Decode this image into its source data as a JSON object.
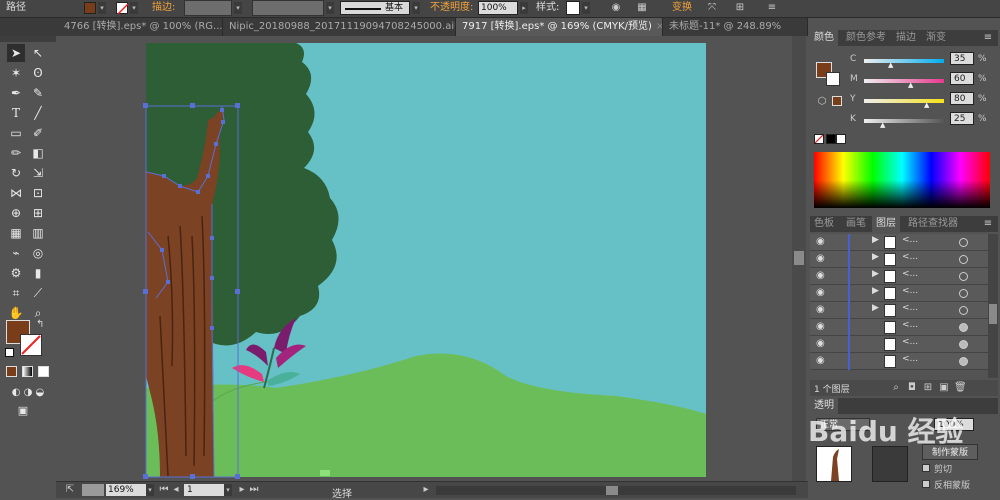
{
  "control_bar": {
    "object_label": "路径",
    "stroke_label": "描边:",
    "stroke_style": "基本",
    "opacity_label": "不透明度:",
    "opacity_value": "100%",
    "style_label": "样式:",
    "transform_label": "变换",
    "fill_color": "#7a3d1a"
  },
  "tabs": [
    {
      "label": "4766 [转换].eps* @ 100% (RG...",
      "close": "×"
    },
    {
      "label": "Nipic_20180988_20171119094708245000.ai*",
      "close": "×"
    },
    {
      "label": "7917 [转换].eps* @ 169% (CMYK/预览)",
      "close": "×"
    },
    {
      "label": "未标题-11* @ 248.89%",
      "close": ""
    }
  ],
  "status_bar": {
    "zoom": "169%",
    "artboard": "1",
    "tool_name": "选择"
  },
  "color_panel": {
    "tabs": [
      "颜色",
      "颜色参考",
      "描边",
      "渐变"
    ],
    "channels": [
      {
        "label": "C",
        "value": "35",
        "percent": 35,
        "color": "#00aeef"
      },
      {
        "label": "M",
        "value": "60",
        "percent": 60,
        "color": "#e8398e"
      },
      {
        "label": "Y",
        "value": "80",
        "percent": 80,
        "color": "#f5e11a"
      },
      {
        "label": "K",
        "value": "25",
        "percent": 25,
        "color": "#555555"
      }
    ],
    "percent_sign": "%"
  },
  "layers_panel": {
    "tabs": [
      "色板",
      "画笔",
      "图层",
      "路径查找器"
    ],
    "row_label": "<...",
    "footer_text": "1 个图层"
  },
  "transparency_panel": {
    "tab": "透明",
    "mode": "正常",
    "opacity": "100%",
    "make_mask": "制作蒙版",
    "clip": "剪切",
    "invert_mask": "反相蒙版"
  },
  "watermark": "Baidu 经验",
  "colors": {
    "sky": "#66c1c7",
    "grass": "#6bbd5a",
    "foliage": "#2d5e35",
    "trunk": "#7b4223",
    "selection": "#5a6fd6"
  }
}
